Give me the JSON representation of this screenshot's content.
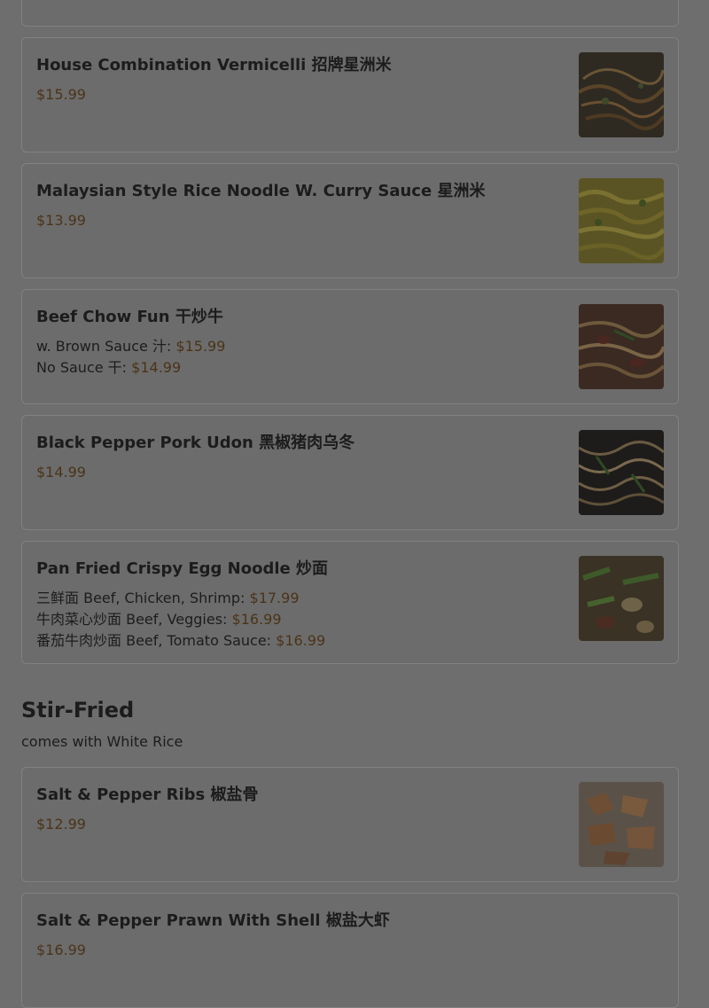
{
  "items": [
    {
      "name": "House Combination Vermicelli 招牌星洲米",
      "prices": [
        {
          "label": "",
          "value": "$15.99"
        }
      ]
    },
    {
      "name": "Malaysian Style Rice Noodle W. Curry Sauce 星洲米",
      "prices": [
        {
          "label": "",
          "value": "$13.99"
        }
      ]
    },
    {
      "name": "Beef Chow Fun 干炒牛",
      "prices": [
        {
          "label": "w. Brown Sauce 汁:",
          "value": "$15.99"
        },
        {
          "label": "No Sauce 干:",
          "value": "$14.99"
        }
      ]
    },
    {
      "name": "Black Pepper Pork Udon 黑椒猪肉乌冬",
      "prices": [
        {
          "label": "",
          "value": "$14.99"
        }
      ]
    },
    {
      "name": "Pan Fried Crispy Egg Noodle 炒面",
      "prices": [
        {
          "label": "三鲜面 Beef, Chicken, Shrimp:",
          "value": "$17.99"
        },
        {
          "label": "牛肉菜心炒面 Beef, Veggies:",
          "value": "$16.99"
        },
        {
          "label": "番茄牛肉炒面 Beef, Tomato Sauce:",
          "value": "$16.99"
        }
      ]
    }
  ],
  "section": {
    "title": "Stir-Fried",
    "subtitle": "comes with White Rice"
  },
  "stirfried_items": [
    {
      "name": "Salt & Pepper Ribs 椒盐骨",
      "prices": [
        {
          "label": "",
          "value": "$12.99"
        }
      ]
    },
    {
      "name": "Salt & Pepper Prawn With Shell 椒盐大虾",
      "prices": [
        {
          "label": "",
          "value": "$16.99"
        }
      ]
    }
  ],
  "colors": {
    "overlay_bg": "#6e6e6e",
    "price": "#4b3418"
  },
  "icons": [
    "food-photo"
  ]
}
